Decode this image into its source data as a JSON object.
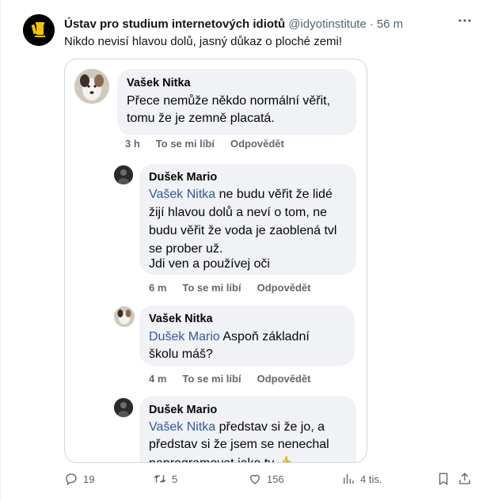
{
  "tweet": {
    "author_name": "Ústav pro studium internetových idiotů",
    "author_handle": "@idyotinstitute",
    "separator": "·",
    "time": "56 m",
    "text": "Nikdo nevisí hlavou dolů, jasný důkaz o ploché zemi!"
  },
  "comments": [
    {
      "name": "Vašek Nitka",
      "lines": [
        "Přece nemůže někdo normální věřit,",
        "tomu že je zemně placatá."
      ],
      "time": "3 h",
      "like": "To se mi líbí",
      "reply": "Odpovědět"
    },
    {
      "name": "Dušek Mario",
      "tag": "Vašek Nitka",
      "lines": [
        " ne budu věřit že lidé",
        "žijí hlavou dolů a neví o tom,  ne",
        "budu věřit že voda je zaoblená tvl",
        "se prober už.",
        "Jdi ven a používej oči"
      ],
      "time": "6 m",
      "like": "To se mi líbí",
      "reply": "Odpovědět"
    },
    {
      "name": "Vašek Nitka",
      "tag": "Dušek Mario",
      "lines": [
        " Aspoň základní",
        "školu máš?"
      ],
      "time": "4 m",
      "like": "To se mi líbí",
      "reply": "Odpovědět"
    },
    {
      "name": "Dušek Mario",
      "tag": "Vašek Nitka",
      "lines": [
        " představ si že jo,  a",
        "představ si že jsem se nenechal",
        "naprogramovat jako ty 👍"
      ]
    }
  ],
  "actions": {
    "replies": "19",
    "retweets": "5",
    "likes": "156",
    "views": "4 tis."
  },
  "icons": [
    "more-icon",
    "reply-icon",
    "retweet-icon",
    "like-icon",
    "views-icon",
    "bookmark-icon",
    "share-icon"
  ]
}
